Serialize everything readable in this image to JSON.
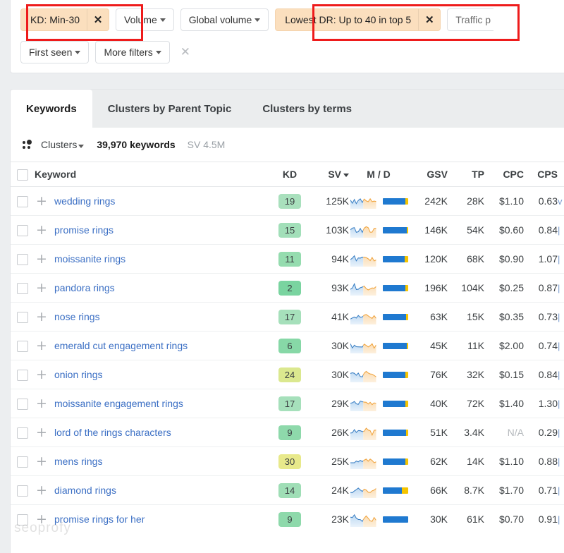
{
  "filters": {
    "row1": [
      {
        "label": "KD: Min-30",
        "active": true,
        "has_close": true,
        "highlighted": true
      },
      {
        "label": "Volume",
        "active": false,
        "has_caret": true
      },
      {
        "label": "Global volume",
        "active": false,
        "has_caret": true
      },
      {
        "label": "Lowest DR: Up to 40 in top 5",
        "active": true,
        "has_close": true,
        "highlighted": true
      },
      {
        "label": "Traffic p",
        "active": false,
        "cut_off": true
      }
    ],
    "row2": [
      {
        "label": "First seen",
        "active": false,
        "has_caret": true
      },
      {
        "label": "More filters",
        "active": false,
        "has_caret": true
      }
    ],
    "clear_all_icon": "close-icon",
    "close_glyph": "✕",
    "chip_active_color": "#fbdfbe",
    "highlight_color": "#ee1b1b"
  },
  "tabs": [
    {
      "label": "Keywords",
      "active": true
    },
    {
      "label": "Clusters by Parent Topic",
      "active": false
    },
    {
      "label": "Clusters by terms",
      "active": false
    }
  ],
  "summary": {
    "clusters_label": "Clusters",
    "clusters_icon": "cluster-dots-icon",
    "keyword_count": "39,970 keywords",
    "sv_total": "SV 4.5M"
  },
  "table": {
    "columns": [
      "Keyword",
      "KD",
      "SV",
      "M / D",
      "GSV",
      "TP",
      "CPC",
      "CPS"
    ],
    "sorted_column": "SV",
    "sort_direction": "desc",
    "select_all_checkbox": false,
    "rows": [
      {
        "keyword": "wedding rings",
        "kd": "19",
        "kd_color": "#a9e0bd",
        "sv": "125K",
        "mobile_pct": 88,
        "gsv": "242K",
        "tp": "28K",
        "cpc": "$1.10",
        "cps": "0.63"
      },
      {
        "keyword": "promise rings",
        "kd": "15",
        "kd_color": "#a2dfb9",
        "sv": "103K",
        "mobile_pct": 94,
        "gsv": "146K",
        "tp": "54K",
        "cpc": "$0.60",
        "cps": "0.84"
      },
      {
        "keyword": "moissanite rings",
        "kd": "11",
        "kd_color": "#95dcaf",
        "sv": "94K",
        "mobile_pct": 86,
        "gsv": "120K",
        "tp": "68K",
        "cpc": "$0.90",
        "cps": "1.07"
      },
      {
        "keyword": "pandora rings",
        "kd": "2",
        "kd_color": "#7ad4a0",
        "sv": "93K",
        "mobile_pct": 89,
        "gsv": "196K",
        "tp": "104K",
        "cpc": "$0.25",
        "cps": "0.87"
      },
      {
        "keyword": "nose rings",
        "kd": "17",
        "kd_color": "#a6e0bb",
        "sv": "41K",
        "mobile_pct": 91,
        "gsv": "63K",
        "tp": "15K",
        "cpc": "$0.35",
        "cps": "0.73"
      },
      {
        "keyword": "emerald cut engagement rings",
        "kd": "6",
        "kd_color": "#87d8a7",
        "sv": "30K",
        "mobile_pct": 94,
        "gsv": "45K",
        "tp": "11K",
        "cpc": "$2.00",
        "cps": "0.74"
      },
      {
        "keyword": "onion rings",
        "kd": "24",
        "kd_color": "#dbe88f",
        "sv": "30K",
        "mobile_pct": 88,
        "gsv": "76K",
        "tp": "32K",
        "cpc": "$0.15",
        "cps": "0.84"
      },
      {
        "keyword": "moissanite engagement rings",
        "kd": "17",
        "kd_color": "#a6e0bb",
        "sv": "29K",
        "mobile_pct": 90,
        "gsv": "40K",
        "tp": "72K",
        "cpc": "$1.40",
        "cps": "1.30"
      },
      {
        "keyword": "lord of the rings characters",
        "kd": "9",
        "kd_color": "#8ed9ab",
        "sv": "26K",
        "mobile_pct": 91,
        "gsv": "51K",
        "tp": "3.4K",
        "cpc": "N/A",
        "cps": "0.29"
      },
      {
        "keyword": "mens rings",
        "kd": "30",
        "kd_color": "#e8e98b",
        "sv": "25K",
        "mobile_pct": 88,
        "gsv": "62K",
        "tp": "14K",
        "cpc": "$1.10",
        "cps": "0.88"
      },
      {
        "keyword": "diamond rings",
        "kd": "14",
        "kd_color": "#9fdeb6",
        "sv": "24K",
        "mobile_pct": 74,
        "gsv": "66K",
        "tp": "8.7K",
        "cpc": "$1.70",
        "cps": "0.71"
      },
      {
        "keyword": "promise rings for her",
        "kd": "9",
        "kd_color": "#8ed9ab",
        "sv": "23K",
        "mobile_pct": 100,
        "gsv": "30K",
        "tp": "61K",
        "cpc": "$0.70",
        "cps": "0.91"
      }
    ]
  },
  "watermark": "seoprofy"
}
